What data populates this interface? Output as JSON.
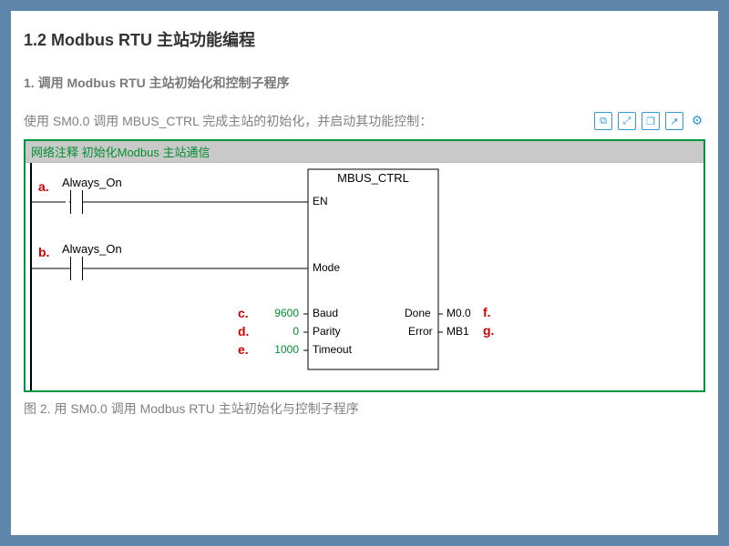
{
  "heading1": "1.2 Modbus RTU 主站功能编程",
  "heading2": "1. 调用 Modbus RTU 主站初始化和控制子程序",
  "body": "使用 SM0.0 调用 MBUS_CTRL 完成主站的初始化，并启动其功能控制：",
  "caption": "图 2. 用 SM0.0 调用 Modbus RTU 主站初始化与控制子程序",
  "toolbar": {
    "copy": "⧉",
    "expand": "⤢",
    "window": "❐",
    "share": "↗",
    "settings": "⚙"
  },
  "ladder": {
    "comment": "网络注释    初始化Modbus 主站通信",
    "rung1": {
      "label": "Always_On",
      "ann": "a."
    },
    "rung2": {
      "label": "Always_On",
      "ann": "b."
    },
    "block": {
      "name": "MBUS_CTRL",
      "pins_left": {
        "en": {
          "name": "EN"
        },
        "mode": {
          "name": "Mode"
        },
        "baud": {
          "name": "Baud",
          "value": "9600",
          "ann": "c."
        },
        "par": {
          "name": "Parity",
          "value": "0",
          "ann": "d."
        },
        "to": {
          "name": "Timeout",
          "value": "1000",
          "ann": "e."
        }
      },
      "pins_right": {
        "done": {
          "name": "Done",
          "value": "M0.0",
          "ann": "f."
        },
        "err": {
          "name": "Error",
          "value": "MB1",
          "ann": "g."
        }
      }
    }
  }
}
